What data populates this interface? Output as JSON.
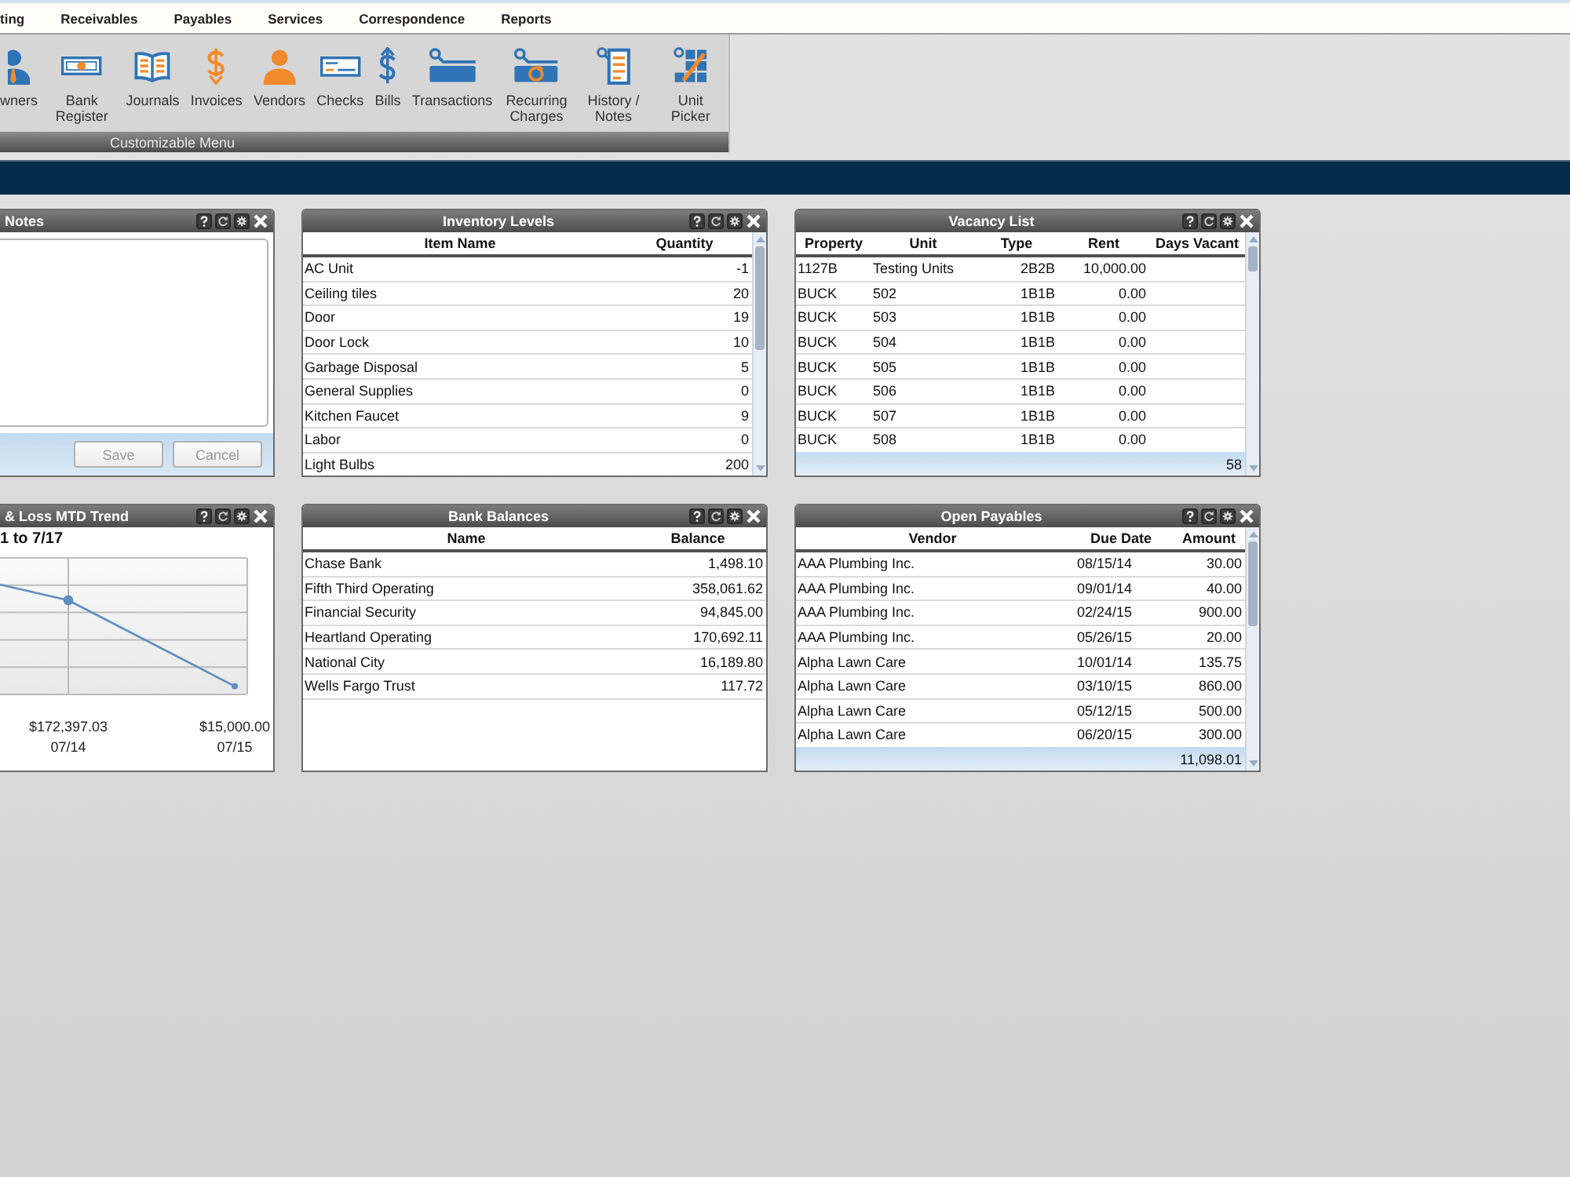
{
  "menu": {
    "items": [
      "ting",
      "Receivables",
      "Payables",
      "Services",
      "Correspondence",
      "Reports"
    ]
  },
  "toolbar": {
    "items": [
      {
        "label": "wners"
      },
      {
        "label": "Bank Register"
      },
      {
        "label": "Journals"
      },
      {
        "label": "Invoices"
      },
      {
        "label": "Vendors"
      },
      {
        "label": "Checks"
      },
      {
        "label": "Bills"
      },
      {
        "label": "Transactions"
      },
      {
        "label": "Recurring Charges"
      },
      {
        "label": "History / Notes"
      },
      {
        "label": "Unit Picker"
      }
    ],
    "caption": "Customizable Menu"
  },
  "widgets": [
    {
      "kind": "notes",
      "title": "Notes",
      "buttons": [
        {
          "label": "Save",
          "disabled": true
        },
        {
          "label": "Cancel",
          "disabled": true
        }
      ]
    },
    {
      "kind": "table",
      "title": "Inventory Levels",
      "columns": [
        {
          "label": "Item Name",
          "kind": "text"
        },
        {
          "label": "Quantity",
          "kind": "number"
        }
      ],
      "rows": [
        [
          "AC Unit",
          "-1"
        ],
        [
          "Ceiling tiles",
          "20"
        ],
        [
          "Door",
          "19"
        ],
        [
          "Door Lock",
          "10"
        ],
        [
          "Garbage Disposal",
          "5"
        ],
        [
          "General Supplies",
          "0"
        ],
        [
          "Kitchen Faucet",
          "9"
        ],
        [
          "Labor",
          "0"
        ],
        [
          "Light Bulbs",
          "200"
        ]
      ]
    },
    {
      "kind": "table",
      "title": "Vacancy List",
      "columns": [
        {
          "label": "Property",
          "kind": "text"
        },
        {
          "label": "Unit",
          "kind": "text"
        },
        {
          "label": "Type",
          "kind": "code"
        },
        {
          "label": "Rent",
          "kind": "number"
        },
        {
          "label": "Days Vacant",
          "kind": "number"
        }
      ],
      "rows": [
        [
          "1127B",
          "Testing Units",
          "2B2B",
          "10,000.00"
        ],
        [
          "BUCK",
          "502",
          "1B1B",
          "0.00"
        ],
        [
          "BUCK",
          "503",
          "1B1B",
          "0.00"
        ],
        [
          "BUCK",
          "504",
          "1B1B",
          "0.00"
        ],
        [
          "BUCK",
          "505",
          "1B1B",
          "0.00"
        ],
        [
          "BUCK",
          "506",
          "1B1B",
          "0.00"
        ],
        [
          "BUCK",
          "507",
          "1B1B",
          "0.00"
        ],
        [
          "BUCK",
          "508",
          "1B1B",
          "0.00"
        ]
      ],
      "footer": "58"
    },
    {
      "kind": "chart",
      "title": "& Loss MTD Trend",
      "subtitle": "1 to 7/17",
      "chart_data": {
        "type": "line",
        "categories": [
          "07/14",
          "07/15"
        ],
        "series": [
          {
            "color": "#5f8fc2",
            "marker": "circle",
            "values": [
              172397.03,
              15000.0
            ],
            "value_labels": [
              "$172,397.03",
              "$15,000.00"
            ]
          }
        ]
      }
    },
    {
      "kind": "table",
      "title": "Bank Balances",
      "columns": [
        {
          "label": "Name",
          "kind": "text"
        },
        {
          "label": "Balance",
          "kind": "number"
        }
      ],
      "rows": [
        [
          "Chase Bank",
          "1,498.10"
        ],
        [
          "Fifth Third Operating",
          "358,061.62"
        ],
        [
          "Financial Security",
          "94,845.00"
        ],
        [
          "Heartland Operating",
          "170,692.11"
        ],
        [
          "National City",
          "16,189.80"
        ],
        [
          "Wells Fargo Trust",
          "117.72"
        ]
      ]
    },
    {
      "kind": "table",
      "title": "Open Payables",
      "columns": [
        {
          "label": "Vendor",
          "kind": "text"
        },
        {
          "label": "Due Date",
          "kind": "date"
        },
        {
          "label": "Amount",
          "kind": "number"
        }
      ],
      "rows": [
        [
          "AAA Plumbing Inc.",
          "08/15/14",
          "30.00"
        ],
        [
          "AAA Plumbing Inc.",
          "09/01/14",
          "40.00"
        ],
        [
          "AAA Plumbing Inc.",
          "02/24/15",
          "900.00"
        ],
        [
          "AAA Plumbing Inc.",
          "05/26/15",
          "20.00"
        ],
        [
          "Alpha Lawn Care",
          "10/01/14",
          "135.75"
        ],
        [
          "Alpha Lawn Care",
          "03/10/15",
          "860.00"
        ],
        [
          "Alpha Lawn Care",
          "05/12/15",
          "500.00"
        ],
        [
          "Alpha Lawn Care",
          "06/20/15",
          "300.00"
        ]
      ],
      "footer": "11,098.01"
    }
  ]
}
